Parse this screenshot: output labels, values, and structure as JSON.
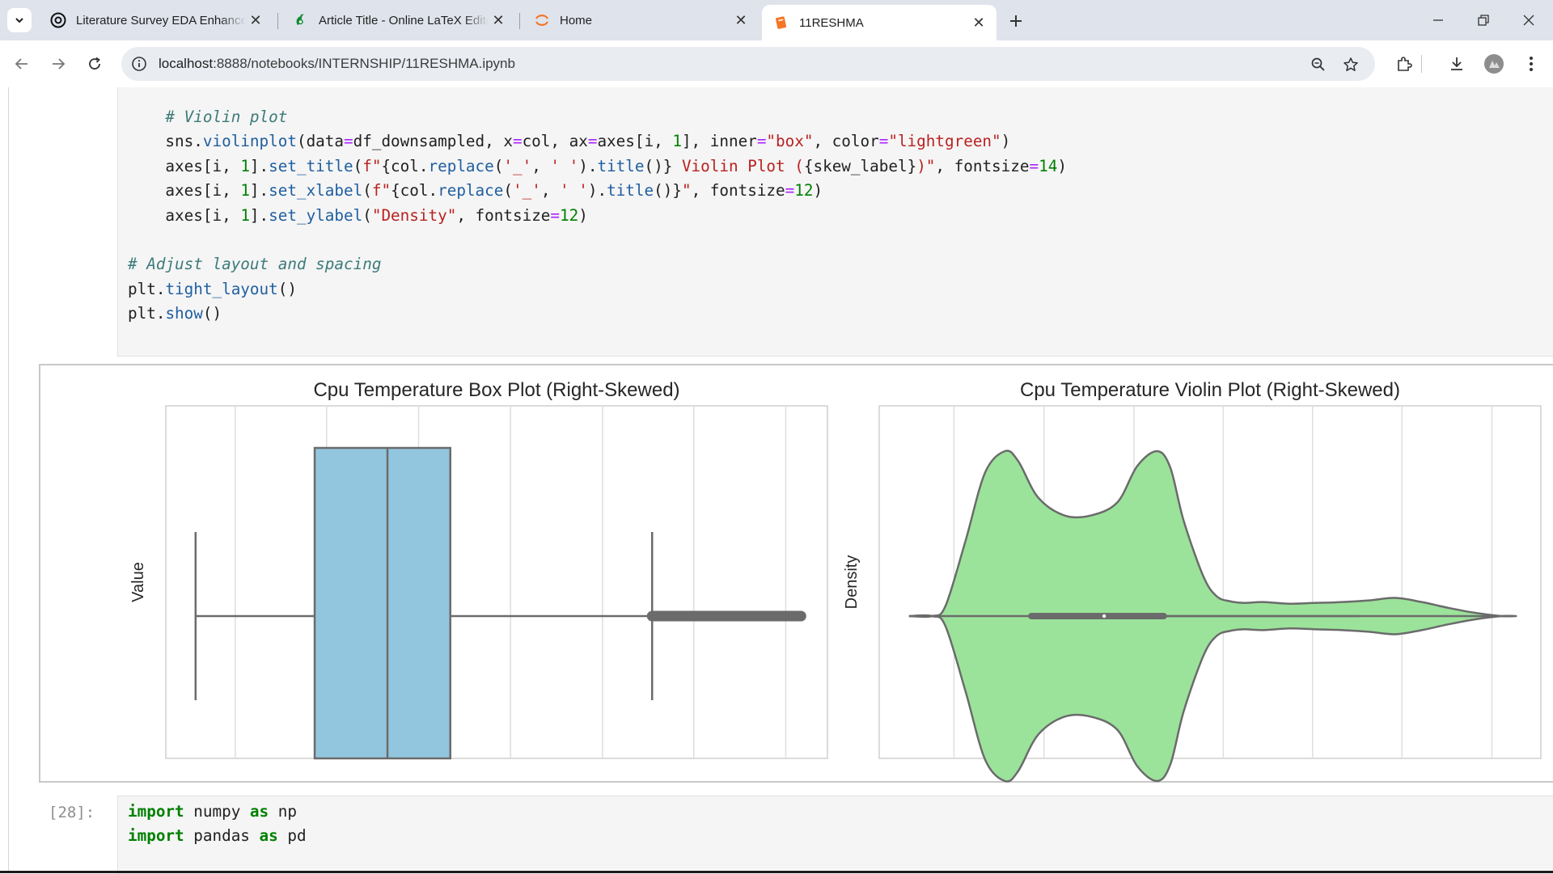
{
  "browser": {
    "tabs": [
      {
        "title": "Literature Survey EDA Enhancement",
        "icon": "openai-icon"
      },
      {
        "title": "Article Title - Online LaTeX Editor",
        "icon": "overleaf-icon"
      },
      {
        "title": "Home",
        "icon": "jupyter-icon"
      },
      {
        "title": "11RESHMA",
        "icon": "notebook-icon",
        "active": true
      }
    ],
    "url_host": "localhost",
    "url_rest": ":8888/notebooks/INTERNSHIP/11RESHMA.ipynb"
  },
  "cell1": {
    "lines": [
      "    # Violin plot",
      "    sns.violinplot(data=df_downsampled, x=col, ax=axes[i, 1], inner=\"box\", color=\"lightgreen\")",
      "    axes[i, 1].set_title(f\"{col.replace('_', ' ').title()} Violin Plot ({skew_label})\", fontsize=14)",
      "    axes[i, 1].set_xlabel(f\"{col.replace('_', ' ').title()}\", fontsize=12)",
      "    axes[i, 1].set_ylabel(\"Density\", fontsize=12)",
      "",
      "# Adjust layout and spacing",
      "plt.tight_layout()",
      "plt.show()"
    ]
  },
  "cell2": {
    "prompt": "[28]:",
    "lines": [
      "import numpy as np",
      "import pandas as pd"
    ]
  },
  "chart_data": [
    {
      "type": "box",
      "title": "Cpu Temperature Box Plot (Right-Skewed)",
      "ylabel": "Value",
      "color": "#92c6df",
      "stats": {
        "whisker_low": 0.045,
        "q1": 0.225,
        "median": 0.335,
        "q3": 0.43,
        "whisker_high": 0.735,
        "outliers_to": 0.96
      },
      "grid_x": [
        0.105,
        0.243,
        0.382,
        0.521,
        0.66,
        0.798,
        0.937
      ]
    },
    {
      "type": "violin",
      "title": "Cpu Temperature Violin Plot (Right-Skewed)",
      "ylabel": "Density",
      "color": "#9be39a",
      "grid_x": [
        0.113,
        0.249,
        0.385,
        0.52,
        0.655,
        0.79,
        0.926
      ],
      "profile_x": [
        0.045,
        0.08,
        0.1,
        0.13,
        0.16,
        0.19,
        0.21,
        0.24,
        0.28,
        0.32,
        0.36,
        0.39,
        0.42,
        0.44,
        0.46,
        0.49,
        0.51,
        0.53,
        0.55,
        0.58,
        0.62,
        0.66,
        0.7,
        0.74,
        0.78,
        0.82,
        0.86,
        0.9,
        0.94,
        0.96
      ],
      "profile_half_width": [
        0.0,
        0.0,
        0.06,
        0.45,
        0.87,
        1.0,
        0.94,
        0.72,
        0.61,
        0.61,
        0.69,
        0.91,
        1.0,
        0.9,
        0.58,
        0.24,
        0.12,
        0.09,
        0.08,
        0.085,
        0.075,
        0.08,
        0.085,
        0.095,
        0.11,
        0.085,
        0.05,
        0.02,
        0.0,
        0.0
      ],
      "inner_box": {
        "q1": 0.23,
        "q3": 0.43,
        "median": 0.34,
        "whisker_high": 0.725
      }
    }
  ]
}
